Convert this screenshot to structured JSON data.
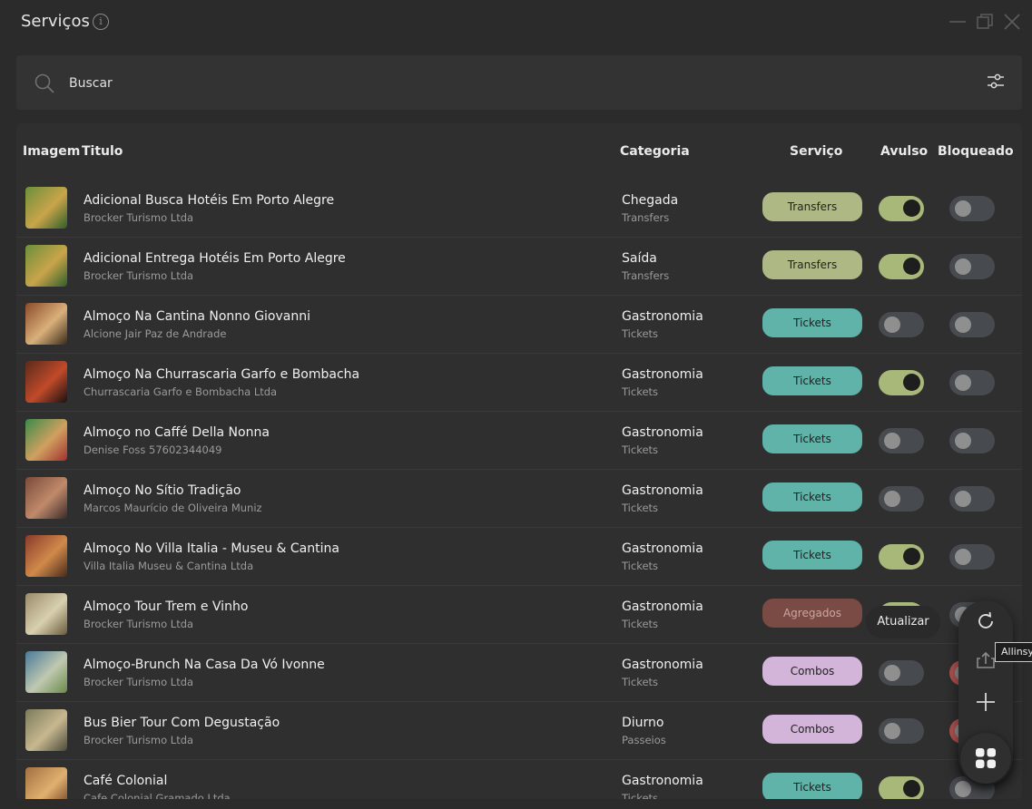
{
  "window": {
    "title": "Serviços"
  },
  "search": {
    "placeholder": "Buscar"
  },
  "table": {
    "headers": {
      "image": "Imagem",
      "title": "Titulo",
      "category": "Categoria",
      "service": "Serviço",
      "avulso": "Avulso",
      "blocked": "Bloqueado"
    },
    "rows": [
      {
        "title": "Adicional Busca Hotéis Em Porto Alegre",
        "subtitle": "Brocker Turismo Ltda",
        "category": "Chegada",
        "category_sub": "Transfers",
        "service": "Transfers",
        "service_color": "#adb885",
        "avulso": true,
        "blocked": false
      },
      {
        "title": "Adicional Entrega Hotéis Em Porto Alegre",
        "subtitle": "Brocker Turismo Ltda",
        "category": "Saída",
        "category_sub": "Transfers",
        "service": "Transfers",
        "service_color": "#adb885",
        "avulso": true,
        "blocked": false
      },
      {
        "title": "Almoço Na Cantina Nonno Giovanni",
        "subtitle": "Alcione Jair Paz de Andrade",
        "category": "Gastronomia",
        "category_sub": "Tickets",
        "service": "Tickets",
        "service_color": "#5fb3a8",
        "avulso": false,
        "blocked": false
      },
      {
        "title": "Almoço Na Churrascaria Garfo e Bombacha",
        "subtitle": "Churrascaria Garfo e Bombacha Ltda",
        "category": "Gastronomia",
        "category_sub": "Tickets",
        "service": "Tickets",
        "service_color": "#5fb3a8",
        "avulso": true,
        "blocked": false
      },
      {
        "title": "Almoço no Caffé Della Nonna",
        "subtitle": "Denise Foss 57602344049",
        "category": "Gastronomia",
        "category_sub": "Tickets",
        "service": "Tickets",
        "service_color": "#5fb3a8",
        "avulso": false,
        "blocked": false
      },
      {
        "title": "Almoço No Sítio Tradição",
        "subtitle": "Marcos Maurício de Oliveira Muniz",
        "category": "Gastronomia",
        "category_sub": "Tickets",
        "service": "Tickets",
        "service_color": "#5fb3a8",
        "avulso": false,
        "blocked": false
      },
      {
        "title": "Almoço No Villa Italia - Museu & Cantina",
        "subtitle": "Villa Italia Museu & Cantina Ltda",
        "category": "Gastronomia",
        "category_sub": "Tickets",
        "service": "Tickets",
        "service_color": "#5fb3a8",
        "avulso": true,
        "blocked": false
      },
      {
        "title": "Almoço Tour Trem e Vinho",
        "subtitle": "Brocker Turismo Ltda",
        "category": "Gastronomia",
        "category_sub": "Tickets",
        "service": "Agregados",
        "service_color": "#7a4a44",
        "avulso": true,
        "blocked": false
      },
      {
        "title": "Almoço-Brunch Na Casa Da Vó Ivonne",
        "subtitle": "Brocker Turismo Ltda",
        "category": "Gastronomia",
        "category_sub": "Tickets",
        "service": "Combos",
        "service_color": "#d2b5d8",
        "avulso": false,
        "blocked": true
      },
      {
        "title": "Bus Bier Tour Com Degustação",
        "subtitle": "Brocker Turismo Ltda",
        "category": "Diurno",
        "category_sub": "Passeios",
        "service": "Combos",
        "service_color": "#d2b5d8",
        "avulso": false,
        "blocked": true
      },
      {
        "title": "Café Colonial",
        "subtitle": "Cafe Colonial Gramado Ltda",
        "category": "Gastronomia",
        "category_sub": "Tickets",
        "service": "Tickets",
        "service_color": "#5fb3a8",
        "avulso": true,
        "blocked": false
      }
    ]
  },
  "fab": {
    "tooltip_refresh": "Atualizar",
    "tooltip_export": "Allinsys"
  },
  "icons": {
    "info": "info-icon",
    "minimize": "minimize-icon",
    "maximize": "restore-icon",
    "close": "close-icon",
    "search": "search-icon",
    "filter": "sliders-icon",
    "refresh": "refresh-icon",
    "upload": "upload-icon",
    "add": "plus-icon",
    "menu": "grid-icon"
  }
}
